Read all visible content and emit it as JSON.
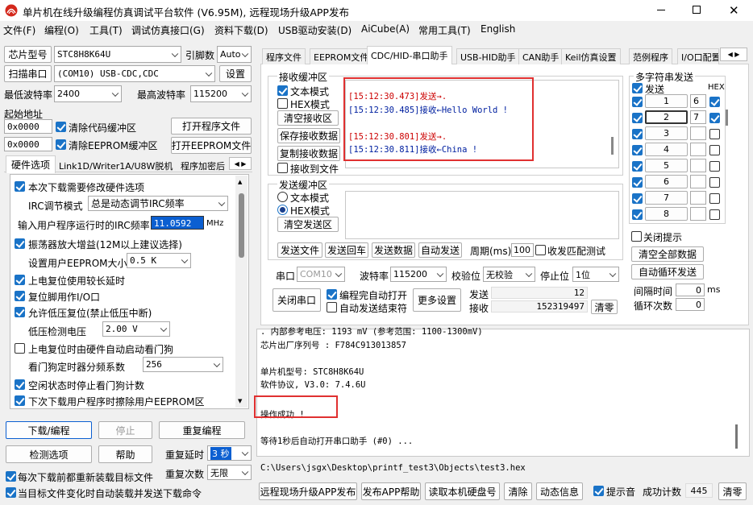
{
  "window": {
    "title": "单片机在线升级编程仿真调试平台软件 (V6.95M), 远程现场升级APP发布"
  },
  "menu": [
    "文件(F)",
    "编程(O)",
    "工具(T)",
    "调试仿真接口(G)",
    "资料下载(D)",
    "USB驱动安装(D)",
    "AiCube(A)",
    "常用工具(T)",
    "English"
  ],
  "left": {
    "chip_label": "芯片型号",
    "chip_value": "STC8H8K64U",
    "pins_label": "引脚数",
    "pins_value": "Auto",
    "scan_label": "扫描串口",
    "port_value": "(COM10) USB-CDC,CDC",
    "settings_label": "设置",
    "min_baud_label": "最低波特率",
    "min_baud_value": "2400",
    "max_baud_label": "最高波特率",
    "max_baud_value": "115200",
    "start_addr_label": "起始地址",
    "addr1": "0x0000",
    "clear_code": "清除代码缓冲区",
    "open_prog": "打开程序文件",
    "addr2": "0x0000",
    "clear_eeprom": "清除EEPROM缓冲区",
    "open_eeprom": "打开EEPROM文件",
    "tabs": [
      "硬件选项",
      "Link1D/Writer1A/U8W脱机",
      "程序加密后"
    ],
    "hw": {
      "opt1": "本次下载需要修改硬件选项",
      "irc_mode_label": "IRC调节模式",
      "irc_mode_value": "总是动态调节IRC频率",
      "irc_freq_label": "输入用户程序运行时的IRC频率",
      "irc_freq_value": "11.0592",
      "irc_unit": "MHz",
      "opt2": "振荡器放大增益(12M以上建议选择)",
      "eeprom_size_label": "设置用户EEPROM大小",
      "eeprom_size_value": "0.5 K",
      "opt3": "上电复位使用较长延时",
      "opt4": "复位脚用作I/O口",
      "opt5": "允许低压复位(禁止低压中断)",
      "lv_label": "低压检测电压",
      "lv_value": "2.00 V",
      "opt6": "上电复位时由硬件自动启动看门狗",
      "wd_label": "看门狗定时器分频系数",
      "wd_value": "256",
      "opt7": "空闲状态时停止看门狗计数",
      "opt8": "下次下载用户程序时擦除用户EEPROM区"
    },
    "download": "下载/编程",
    "stop": "停止",
    "reprogram": "重复编程",
    "check": "检测选项",
    "help": "帮助",
    "delay_label": "重复延时",
    "delay_value": "3 秒",
    "count_label": "重复次数",
    "count_value": "无限",
    "reload1": "每次下载前都重新装载目标文件",
    "reload2": "当目标文件变化时自动装载并发送下载命令"
  },
  "right": {
    "tabs": [
      "程序文件",
      "EEPROM文件",
      "CDC/HID-串口助手",
      "USB-HID助手",
      "CAN助手",
      "Keil仿真设置",
      "范例程序",
      "I/O口配置"
    ],
    "recv": {
      "title": "接收缓冲区",
      "text_mode": "文本模式",
      "hex_mode": "HEX模式",
      "clear": "清空接收区",
      "save": "保存接收数据",
      "copy": "复制接收数据",
      "to_file": "接收到文件",
      "lines": [
        {
          "text": "[15:12:30.473]发送→.",
          "color": "#c00000"
        },
        {
          "text": "[15:12:30.485]接收←Hello World !",
          "color": "#0020a0"
        },
        {
          "text": "",
          "color": "#000"
        },
        {
          "text": "[15:12:30.801]发送→.",
          "color": "#c00000"
        },
        {
          "text": "[15:12:30.811]接收←China !",
          "color": "#0020a0"
        }
      ]
    },
    "send": {
      "title": "发送缓冲区",
      "text_mode": "文本模式",
      "hex_mode": "HEX模式",
      "clear": "清空发送区",
      "send_file": "发送文件",
      "send_back": "发送回车",
      "send_data": "发送数据",
      "auto_send": "自动发送",
      "period_label": "周期(ms)",
      "period_value": "100",
      "match": "收发匹配测试"
    },
    "port": {
      "label": "串口",
      "value": "COM10",
      "baud_label": "波特率",
      "baud_value": "115200",
      "check_label": "校验位",
      "check_value": "无校验",
      "stop_label": "停止位",
      "stop_value": "1位",
      "close": "关闭串口",
      "auto_open": "编程完自动打开",
      "auto_end": "自动发送结束符",
      "more": "更多设置",
      "sent_label": "发送",
      "sent_value": "12",
      "recv_label": "接收",
      "recv_value": "152319497",
      "reset": "清零"
    },
    "multi": {
      "title": "多字符串发送",
      "send_label": "发送",
      "hex_label": "HEX",
      "rows": [
        {
          "n": "1",
          "v": "6"
        },
        {
          "n": "2",
          "v": "7"
        },
        {
          "n": "3",
          "v": ""
        },
        {
          "n": "4",
          "v": ""
        },
        {
          "n": "5",
          "v": ""
        },
        {
          "n": "6",
          "v": ""
        },
        {
          "n": "7",
          "v": ""
        },
        {
          "n": "8",
          "v": ""
        }
      ],
      "close_tip": "关闭提示",
      "clear_all": "清空全部数据",
      "auto_loop": "自动循环发送",
      "interval_label": "间隔时间",
      "interval_value": "0",
      "interval_unit": "ms",
      "loop_label": "循环次数",
      "loop_value": "0"
    }
  },
  "log": {
    "lines": [
      {
        "text": "  . 内部参考电压: 1193 mV (参考范围: 1100-1300mV)"
      },
      {
        "text": "芯片出厂序列号 : F784C913013857"
      },
      {
        "text": ""
      },
      {
        "text": "  单片机型号: STC8H8K64U"
      },
      {
        "text": "  软件协议, V3.0: 7.4.6U"
      },
      {
        "text": ""
      },
      {
        "text": "操作成功 !"
      },
      {
        "text": ""
      },
      {
        "text": "等待1秒后自动打开串口助手 (#0) ..."
      }
    ]
  },
  "path": "C:\\Users\\jsgx\\Desktop\\printf_test3\\Objects\\test3.hex",
  "bottom": {
    "remote": "远程现场升级APP发布",
    "publish_help": "发布APP帮助",
    "read_disk": "读取本机硬盘号",
    "clear": "清除",
    "dynamic": "动态信息",
    "beep": "提示音",
    "success_label": "成功计数",
    "success_value": "445",
    "clear2": "清零"
  }
}
